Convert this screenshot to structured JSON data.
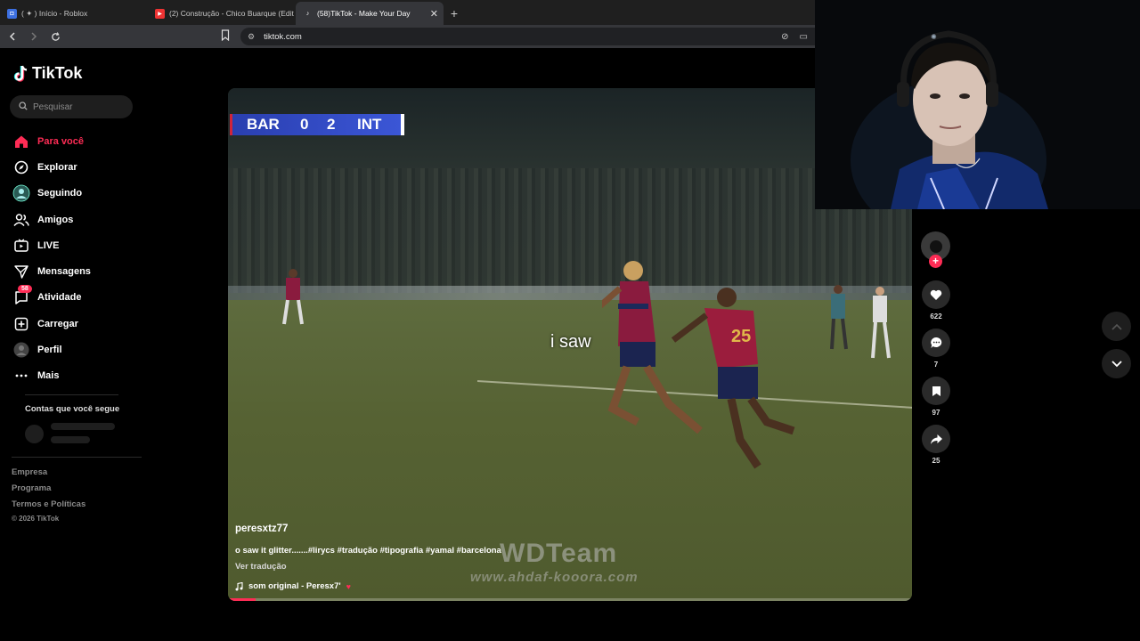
{
  "browser": {
    "tabs": [
      {
        "label": "( ✦ ) Início - Roblox",
        "active": false
      },
      {
        "label": "(2) Construção - Chico Buarque (Edit",
        "active": false
      },
      {
        "label": "(58)TikTok - Make Your Day",
        "active": true
      }
    ],
    "url": "tiktok.com"
  },
  "sidebar": {
    "logo": "TikTok",
    "search_placeholder": "Pesquisar",
    "nav": [
      {
        "label": "Para você",
        "icon": "home-icon",
        "active": true
      },
      {
        "label": "Explorar",
        "icon": "compass-icon"
      },
      {
        "label": "Seguindo",
        "icon": "following-avatar-icon"
      },
      {
        "label": "Amigos",
        "icon": "friends-icon"
      },
      {
        "label": "LIVE",
        "icon": "live-icon"
      },
      {
        "label": "Mensagens",
        "icon": "messages-icon"
      },
      {
        "label": "Atividade",
        "icon": "activity-icon",
        "badge": "58"
      },
      {
        "label": "Carregar",
        "icon": "upload-icon"
      },
      {
        "label": "Perfil",
        "icon": "profile-icon"
      },
      {
        "label": "Mais",
        "icon": "more-icon"
      }
    ],
    "following_title": "Contas que você segue",
    "footer": [
      "Empresa",
      "Programa",
      "Termos e Políticas"
    ],
    "copyright": "© 2026 TikTok"
  },
  "video": {
    "scoreboard": {
      "home": "BAR",
      "home_score": "0",
      "away_score": "2",
      "away": "INT"
    },
    "caption_overlay": "i saw",
    "username": "peresxtz77",
    "description": "o saw it glitter.......#lirycs #tradução #tipografia #yamal #barcelona",
    "translate": "Ver tradução",
    "sound": "som original - Peresx7'",
    "watermark": "WDTeam",
    "watermark_url": "www.ahdaf-kooora.com",
    "progress": 0.04
  },
  "actions": {
    "likes": "622",
    "comments": "7",
    "saves": "97",
    "shares": "25"
  },
  "colors": {
    "accent": "#fe2c55"
  }
}
